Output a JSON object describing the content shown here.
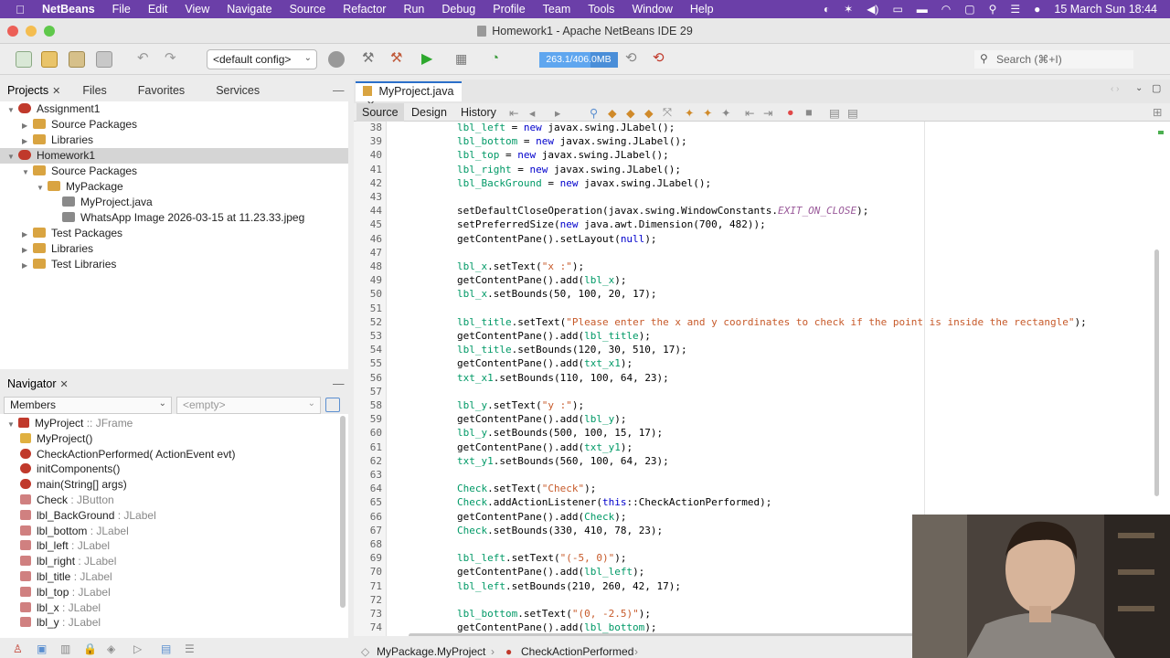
{
  "menubar": {
    "app": "NetBeans",
    "items": [
      "File",
      "Edit",
      "View",
      "Navigate",
      "Source",
      "Refactor",
      "Run",
      "Debug",
      "Profile",
      "Team",
      "Tools",
      "Window",
      "Help"
    ],
    "datetime": "15 March Sun  18:44"
  },
  "window": {
    "title": "Homework1 - Apache NetBeans IDE 29"
  },
  "toolbar": {
    "config": "<default config>",
    "memory": "263.1/406.0MB",
    "memory_fraction": 0.65,
    "search_placeholder": "Search (⌘+I)"
  },
  "left_tabs": [
    "Projects",
    "Files",
    "Favorites",
    "Services"
  ],
  "projects_tree": [
    {
      "label": "Assignment1",
      "level": 0,
      "kind": "project",
      "open": true
    },
    {
      "label": "Source Packages",
      "level": 1,
      "kind": "folder"
    },
    {
      "label": "Libraries",
      "level": 1,
      "kind": "folder"
    },
    {
      "label": "Homework1",
      "level": 0,
      "kind": "project",
      "open": true,
      "selected": true
    },
    {
      "label": "Source Packages",
      "level": 1,
      "kind": "folder",
      "open": true
    },
    {
      "label": "MyPackage",
      "level": 2,
      "kind": "package",
      "open": true
    },
    {
      "label": "MyProject.java",
      "level": 3,
      "kind": "file"
    },
    {
      "label": "WhatsApp Image 2026-03-15 at 11.23.33.jpeg",
      "level": 3,
      "kind": "file"
    },
    {
      "label": "Test Packages",
      "level": 1,
      "kind": "folder"
    },
    {
      "label": "Libraries",
      "level": 1,
      "kind": "folder"
    },
    {
      "label": "Test Libraries",
      "level": 1,
      "kind": "folder"
    }
  ],
  "navigator": {
    "title": "Navigator",
    "members_label": "Members",
    "filter_label": "<empty>",
    "items": [
      {
        "name": "MyProject",
        "type": ":: JFrame"
      },
      {
        "name": "MyProject()",
        "type": ""
      },
      {
        "name": "CheckActionPerformed(",
        "type": "ActionEvent evt)"
      },
      {
        "name": "initComponents()",
        "type": ""
      },
      {
        "name": "main(String[] args)",
        "type": ""
      },
      {
        "name": "Check",
        "type": ": JButton"
      },
      {
        "name": "lbl_BackGround",
        "type": ": JLabel"
      },
      {
        "name": "lbl_bottom",
        "type": ": JLabel"
      },
      {
        "name": "lbl_left",
        "type": ": JLabel"
      },
      {
        "name": "lbl_right",
        "type": ": JLabel"
      },
      {
        "name": "lbl_title",
        "type": ": JLabel"
      },
      {
        "name": "lbl_top",
        "type": ": JLabel"
      },
      {
        "name": "lbl_x",
        "type": ": JLabel"
      },
      {
        "name": "lbl_y",
        "type": ": JLabel"
      }
    ]
  },
  "editor": {
    "file_tab": "MyProject.java",
    "view_tabs": [
      "Source",
      "Design",
      "History"
    ],
    "lines": [
      {
        "n": "38",
        "code": "lbl_left = new javax.swing.JLabel();"
      },
      {
        "n": "39",
        "code": "lbl_bottom = new javax.swing.JLabel();"
      },
      {
        "n": "40",
        "code": "lbl_top = new javax.swing.JLabel();"
      },
      {
        "n": "41",
        "code": "lbl_right = new javax.swing.JLabel();"
      },
      {
        "n": "42",
        "code": "lbl_BackGround = new javax.swing.JLabel();"
      },
      {
        "n": "43",
        "code": ""
      },
      {
        "n": "44",
        "code": "setDefaultCloseOperation(javax.swing.WindowConstants.EXIT_ON_CLOSE);"
      },
      {
        "n": "45",
        "code": "setPreferredSize(new java.awt.Dimension(700, 482));"
      },
      {
        "n": "46",
        "code": "getContentPane().setLayout(null);"
      },
      {
        "n": "47",
        "code": ""
      },
      {
        "n": "48",
        "code": "lbl_x.setText(\"x :\");"
      },
      {
        "n": "49",
        "code": "getContentPane().add(lbl_x);"
      },
      {
        "n": "50",
        "code": "lbl_x.setBounds(50, 100, 20, 17);"
      },
      {
        "n": "51",
        "code": ""
      },
      {
        "n": "52",
        "code": "lbl_title.setText(\"Please enter the x and y coordinates to check if the point is inside the rectangle\");"
      },
      {
        "n": "53",
        "code": "getContentPane().add(lbl_title);"
      },
      {
        "n": "54",
        "code": "lbl_title.setBounds(120, 30, 510, 17);"
      },
      {
        "n": "55",
        "code": "getContentPane().add(txt_x1);"
      },
      {
        "n": "56",
        "code": "txt_x1.setBounds(110, 100, 64, 23);"
      },
      {
        "n": "57",
        "code": ""
      },
      {
        "n": "58",
        "code": "lbl_y.setText(\"y :\");"
      },
      {
        "n": "59",
        "code": "getContentPane().add(lbl_y);"
      },
      {
        "n": "60",
        "code": "lbl_y.setBounds(500, 100, 15, 17);"
      },
      {
        "n": "61",
        "code": "getContentPane().add(txt_y1);"
      },
      {
        "n": "62",
        "code": "txt_y1.setBounds(560, 100, 64, 23);"
      },
      {
        "n": "63",
        "code": ""
      },
      {
        "n": "64",
        "code": "Check.setText(\"Check\");"
      },
      {
        "n": "65",
        "code": "Check.addActionListener(this::CheckActionPerformed);"
      },
      {
        "n": "66",
        "code": "getContentPane().add(Check);"
      },
      {
        "n": "67",
        "code": "Check.setBounds(330, 410, 78, 23);"
      },
      {
        "n": "68",
        "code": ""
      },
      {
        "n": "69",
        "code": "lbl_left.setText(\"(-5, 0)\");"
      },
      {
        "n": "70",
        "code": "getContentPane().add(lbl_left);"
      },
      {
        "n": "71",
        "code": "lbl_left.setBounds(210, 260, 42, 17);"
      },
      {
        "n": "72",
        "code": ""
      },
      {
        "n": "73",
        "code": "lbl_bottom.setText(\"(0, -2.5)\");"
      },
      {
        "n": "74",
        "code": "getContentPane().add(lbl_bottom);"
      }
    ]
  },
  "statusbar": {
    "breadcrumb_1": "MyPackage.MyProject",
    "breadcrumb_2": "CheckActionPerformed"
  },
  "colors": {
    "menubar": "#6b3fa8",
    "field": "#009966",
    "string": "#c75a2a",
    "keyword": "#0000cc",
    "accent": "#2b6fc9"
  }
}
